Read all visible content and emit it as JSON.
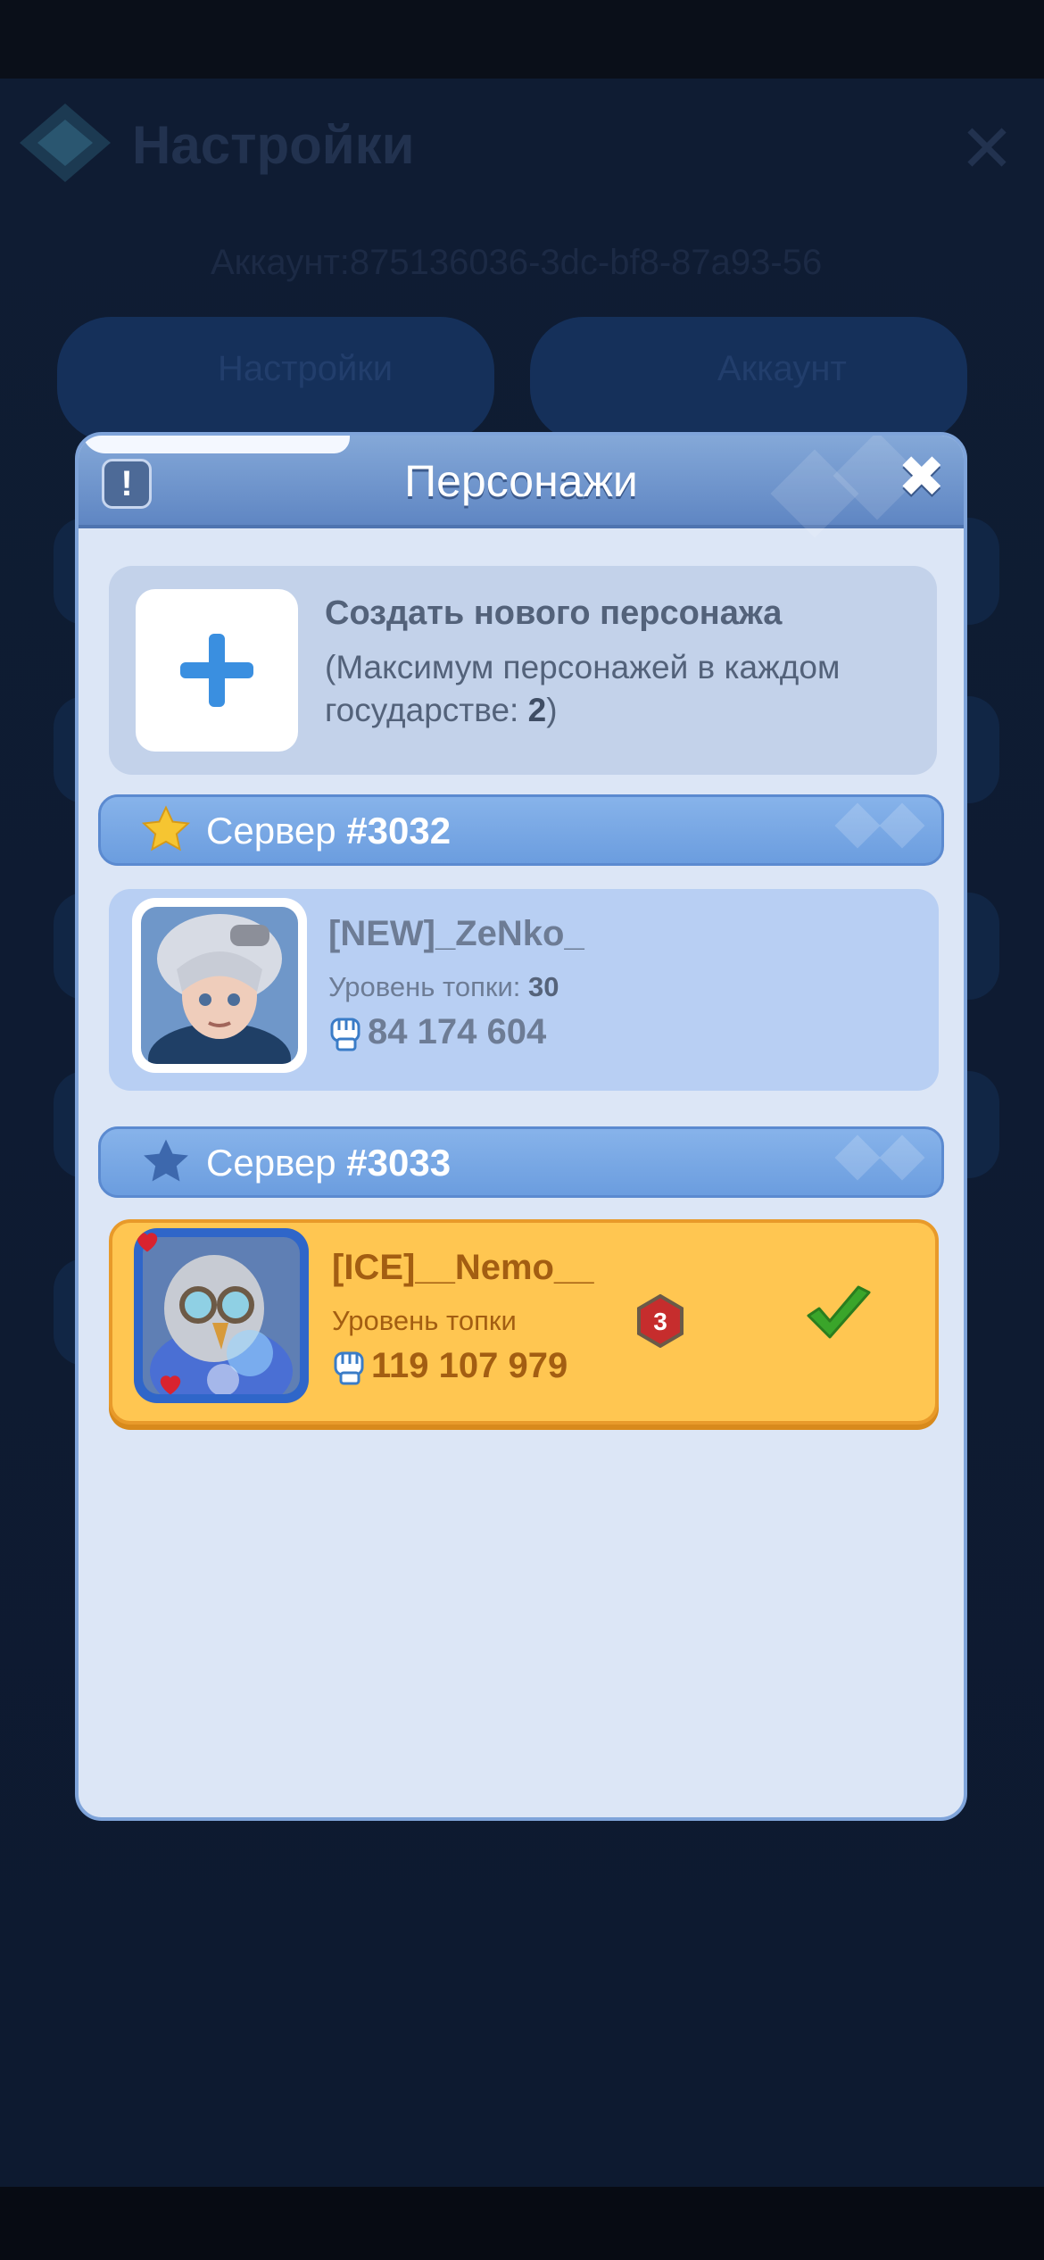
{
  "background": {
    "title": "Настройки",
    "info_text": "Аккаунт:875136036-3dc-bf8-87a93-56",
    "buttons": [
      "Настройки",
      "Аккаунт"
    ]
  },
  "modal": {
    "title": "Персонажи",
    "info_icon": "exclamation-icon",
    "close_icon": "close-icon",
    "create": {
      "title": "Создать нового персонажа",
      "subtitle_prefix": "(Максимум персонажей в каждом государстве: ",
      "max_value": "2",
      "subtitle_suffix": ")"
    },
    "servers": [
      {
        "label": "Сервер ",
        "number": "#3032",
        "star_color": "#f6c531",
        "character": {
          "name": "[NEW]_ZeNko_",
          "level_label": "Уровень топки: ",
          "level_value": "30",
          "power": "84 174 604",
          "selected": false
        }
      },
      {
        "label": "Сервер ",
        "number": "#3033",
        "star_color": "#3d68ad",
        "character": {
          "name": "[ICE]__Nemo__",
          "level_label": "Уровень топки",
          "level_badge": "3",
          "power": "119 107 979",
          "selected": true
        }
      }
    ]
  },
  "colors": {
    "accent": "#6b9ddf",
    "selected_card": "#ffc651",
    "check": "#3aa52a"
  }
}
